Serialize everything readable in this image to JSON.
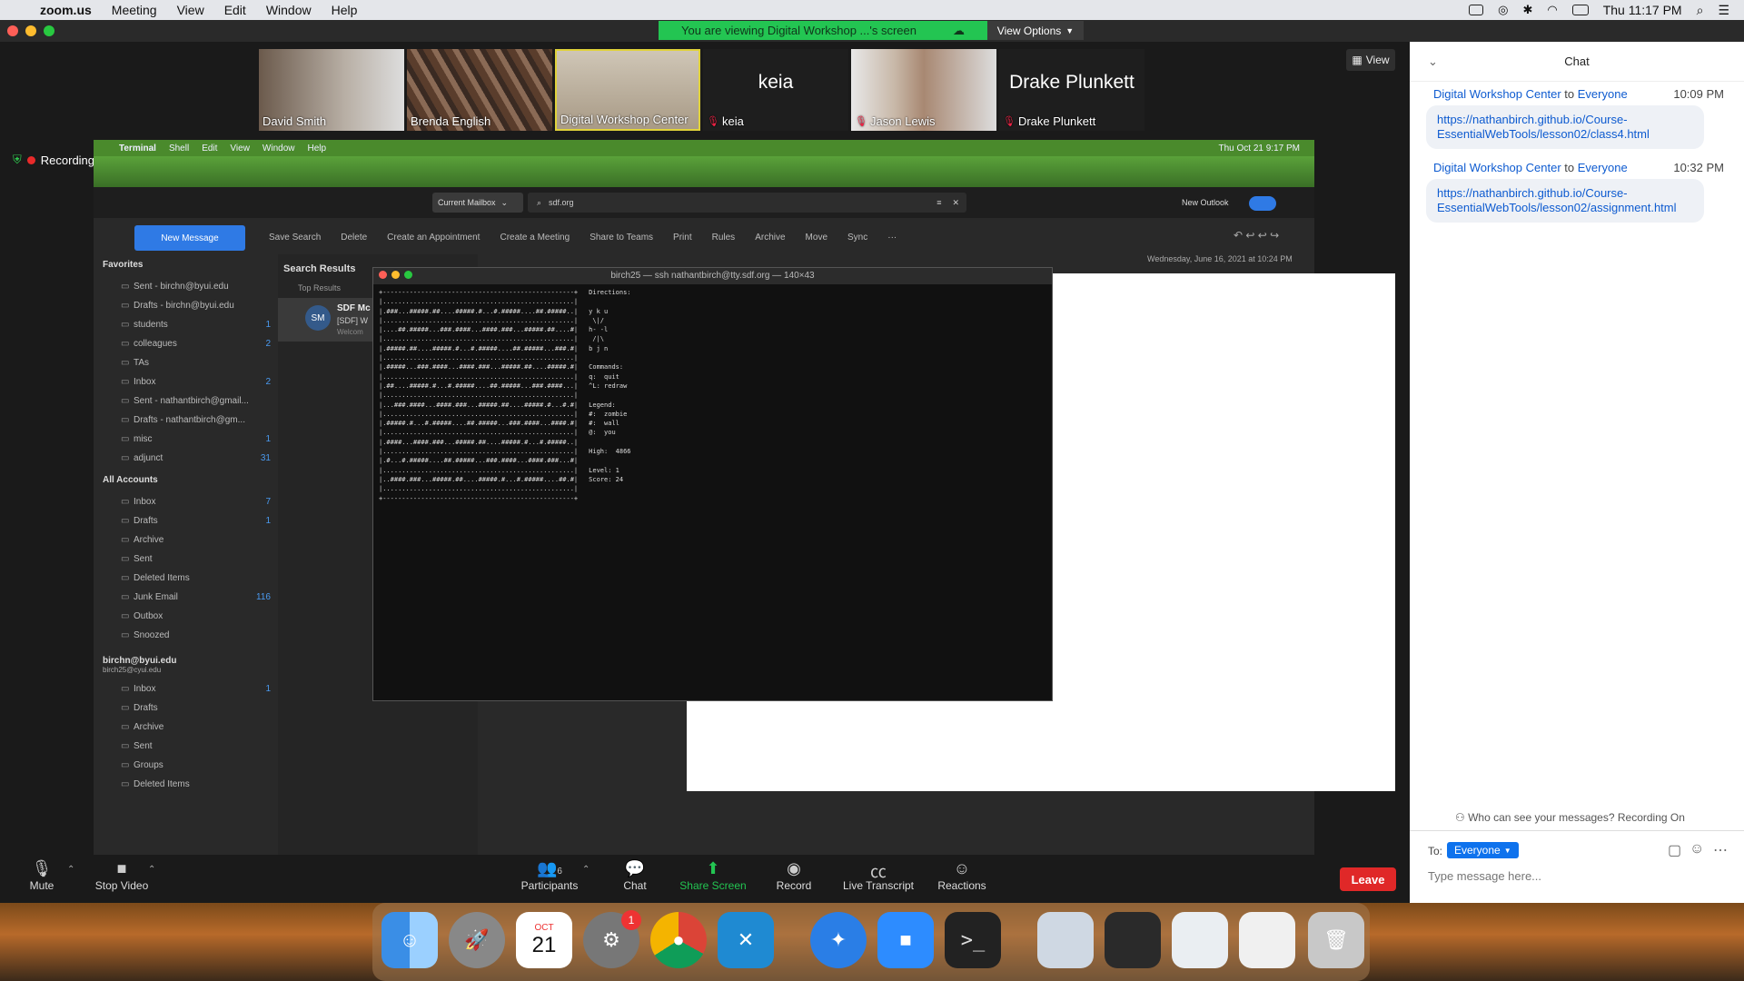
{
  "menubar": {
    "app": "zoom.us",
    "items": [
      "Meeting",
      "View",
      "Edit",
      "Window",
      "Help"
    ],
    "clock": "Thu 11:17 PM"
  },
  "banner": {
    "viewing": "You are viewing Digital Workshop ...'s screen",
    "view_options": "View Options"
  },
  "gallery": [
    {
      "name": "David Smith",
      "muted": false,
      "video": true
    },
    {
      "name": "Brenda English",
      "muted": false,
      "video": true
    },
    {
      "name": "Digital Workshop Center",
      "muted": false,
      "video": true,
      "active": true
    },
    {
      "name": "keia",
      "muted": true,
      "video": false
    },
    {
      "name": "Jason Lewis",
      "muted": true,
      "video": true
    },
    {
      "name": "Drake Plunkett",
      "muted": true,
      "video": false
    }
  ],
  "view_button": "View",
  "recording": "Recording",
  "shared": {
    "mac_menu": [
      "Terminal",
      "Shell",
      "Edit",
      "View",
      "Window",
      "Help"
    ],
    "mac_clock": "Thu Oct 21  9:17 PM",
    "outlook": {
      "mailbox_select": "Current Mailbox",
      "search_value": "sdf.org",
      "new_outlook": "New Outlook",
      "new_message": "New Message",
      "toolbar": [
        "Save Search",
        "Delete",
        "Create an Appointment",
        "Create a Meeting",
        "Share to Teams",
        "Print",
        "Rules",
        "Archive",
        "Move",
        "Sync",
        "···"
      ],
      "favorites_label": "Favorites",
      "favorites": [
        {
          "label": "Sent - birchn@byui.edu",
          "count": ""
        },
        {
          "label": "Drafts - birchn@byui.edu",
          "count": ""
        },
        {
          "label": "students",
          "count": "1"
        },
        {
          "label": "colleagues",
          "count": "2"
        },
        {
          "label": "TAs",
          "count": ""
        },
        {
          "label": "Inbox",
          "count": "2"
        },
        {
          "label": "Sent - nathantbirch@gmail...",
          "count": ""
        },
        {
          "label": "Drafts - nathantbirch@gm...",
          "count": ""
        },
        {
          "label": "misc",
          "count": "1"
        },
        {
          "label": "adjunct",
          "count": "31"
        }
      ],
      "all_accounts_label": "All Accounts",
      "all_accounts": [
        {
          "label": "Inbox",
          "count": "7"
        },
        {
          "label": "Drafts",
          "count": "1"
        },
        {
          "label": "Archive",
          "count": ""
        },
        {
          "label": "Sent",
          "count": ""
        },
        {
          "label": "Deleted Items",
          "count": ""
        },
        {
          "label": "Junk Email",
          "count": "116"
        },
        {
          "label": "Outbox",
          "count": ""
        },
        {
          "label": "Snoozed",
          "count": ""
        }
      ],
      "account_name": "birchn@byui.edu",
      "account_email": "birch25@cyui.edu",
      "account_folders": [
        {
          "label": "Inbox",
          "count": "1"
        },
        {
          "label": "Drafts",
          "count": ""
        },
        {
          "label": "Archive",
          "count": ""
        },
        {
          "label": "Sent",
          "count": ""
        },
        {
          "label": "Groups",
          "count": ""
        },
        {
          "label": "Deleted Items",
          "count": ""
        }
      ],
      "search_results": "Search Results",
      "top_results": "Top Results",
      "result_initials": "SM",
      "result_from": "SDF Mc",
      "result_subject": "[SDF] W",
      "result_preview": "Welcom",
      "reading_date": "Wednesday, June 16, 2021 at 10:24 PM"
    },
    "terminal": {
      "title": "birch25 — ssh nathantbirch@tty.sdf.org — 140×43",
      "directions": "Directions:",
      "keys": "y k u\n \\|/\nh- -l\n /|\\\nb j n",
      "commands_label": "Commands:",
      "commands": "q:  quit\n^L: redraw",
      "legend_label": "Legend:",
      "legend": "#:  zombie\n#:  wall\n@:  you",
      "high": "High:  4866",
      "level": "Level: 1",
      "score": "Score: 24"
    }
  },
  "toolbar": {
    "mute": "Mute",
    "stop_video": "Stop Video",
    "participants": "Participants",
    "participants_count": "6",
    "chat": "Chat",
    "share_screen": "Share Screen",
    "record": "Record",
    "live_transcript": "Live Transcript",
    "reactions": "Reactions",
    "leave": "Leave"
  },
  "chat": {
    "title": "Chat",
    "messages": [
      {
        "from": "Digital Workshop Center",
        "to_word": "to",
        "to": "Everyone",
        "time": "10:09 PM",
        "text": "https://nathanbirch.github.io/Course-EssentialWebTools/lesson02/class4.html"
      },
      {
        "from": "Digital Workshop Center",
        "to_word": "to",
        "to": "Everyone",
        "time": "10:32 PM",
        "text": "https://nathanbirch.github.io/Course-EssentialWebTools/lesson02/assignment.html"
      }
    ],
    "who_can_see": "Who can see your messages? Recording On",
    "to_label": "To:",
    "to_value": "Everyone",
    "placeholder": "Type message here..."
  },
  "dock": {
    "calendar_month": "OCT",
    "calendar_day": "21",
    "settings_badge": "1"
  },
  "colors": {
    "zoom_green": "#23c552",
    "leave_red": "#e02828",
    "chat_blue": "#0e5bd0",
    "outlook_blue": "#2f7ae5"
  }
}
